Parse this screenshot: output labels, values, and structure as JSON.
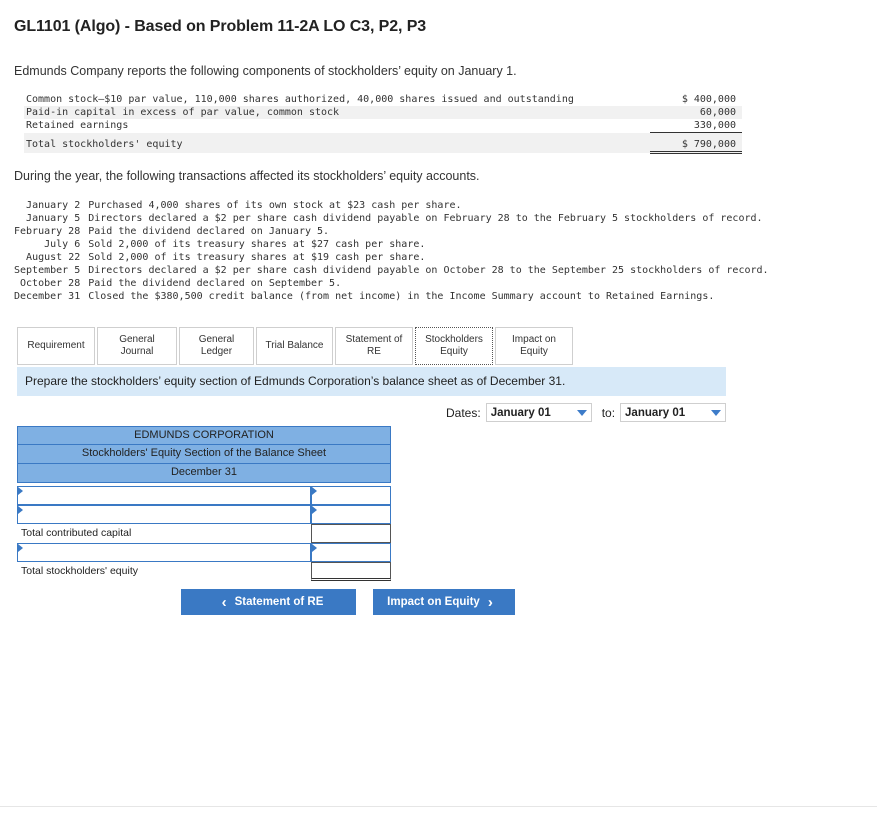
{
  "title": "GL1101 (Algo) - Based on Problem 11-2A LO C3, P2, P3",
  "intro": "Edmunds Company reports the following components of stockholders’ equity on January 1.",
  "equity_components": [
    {
      "label": "Common stock—$10 par value, 110,000 shares authorized, 40,000 shares issued and outstanding",
      "amount": "$ 400,000"
    },
    {
      "label": "Paid-in capital in excess of par value, common stock",
      "amount": "60,000"
    },
    {
      "label": "Retained earnings",
      "amount": "330,000"
    }
  ],
  "equity_total": {
    "label": "Total stockholders' equity",
    "amount": "$ 790,000"
  },
  "during": "During the year, the following transactions affected its stockholders’ equity accounts.",
  "transactions": [
    {
      "date": "January 2",
      "text": "Purchased 4,000 shares of its own stock at $23 cash per share."
    },
    {
      "date": "January 5",
      "text": "Directors declared a $2 per share cash dividend payable on February 28 to the February 5 stockholders of record."
    },
    {
      "date": "February 28",
      "text": "Paid the dividend declared on January 5."
    },
    {
      "date": "July 6",
      "text": "Sold 2,000 of its treasury shares at $27 cash per share."
    },
    {
      "date": "August 22",
      "text": "Sold 2,000 of its treasury shares at $19 cash per share."
    },
    {
      "date": "September 5",
      "text": "Directors declared a $2 per share cash dividend payable on October 28 to the September 25 stockholders of record."
    },
    {
      "date": "October 28",
      "text": "Paid the dividend declared on September 5."
    },
    {
      "date": "December 31",
      "text": "Closed the $380,500 credit balance (from net income) in the Income Summary account to Retained Earnings."
    }
  ],
  "tabs": [
    {
      "line1": "Requirement",
      "line2": ""
    },
    {
      "line1": "General",
      "line2": "Journal"
    },
    {
      "line1": "General",
      "line2": "Ledger"
    },
    {
      "line1": "Trial Balance",
      "line2": ""
    },
    {
      "line1": "Statement of",
      "line2": "RE"
    },
    {
      "line1": "Stockholders",
      "line2": "Equity"
    },
    {
      "line1": "Impact on",
      "line2": "Equity"
    }
  ],
  "instruction": "Prepare the stockholders’ equity section of Edmunds Corporation’s balance sheet as of December 31.",
  "dates": {
    "label": "Dates:",
    "from": "January 01",
    "to_label": "to:",
    "to": "January 01"
  },
  "sheet": {
    "company": "EDMUNDS CORPORATION",
    "heading": "Stockholders' Equity Section of the Balance Sheet",
    "date": "December 31",
    "total_contributed": "Total contributed capital",
    "total_equity": "Total stockholders' equity"
  },
  "nav": {
    "prev": "Statement of RE",
    "next": "Impact on Equity"
  },
  "colors": {
    "accent": "#3a79c4",
    "header_fill": "#7fb0e3",
    "instruction_bg": "#d7e9f8"
  }
}
